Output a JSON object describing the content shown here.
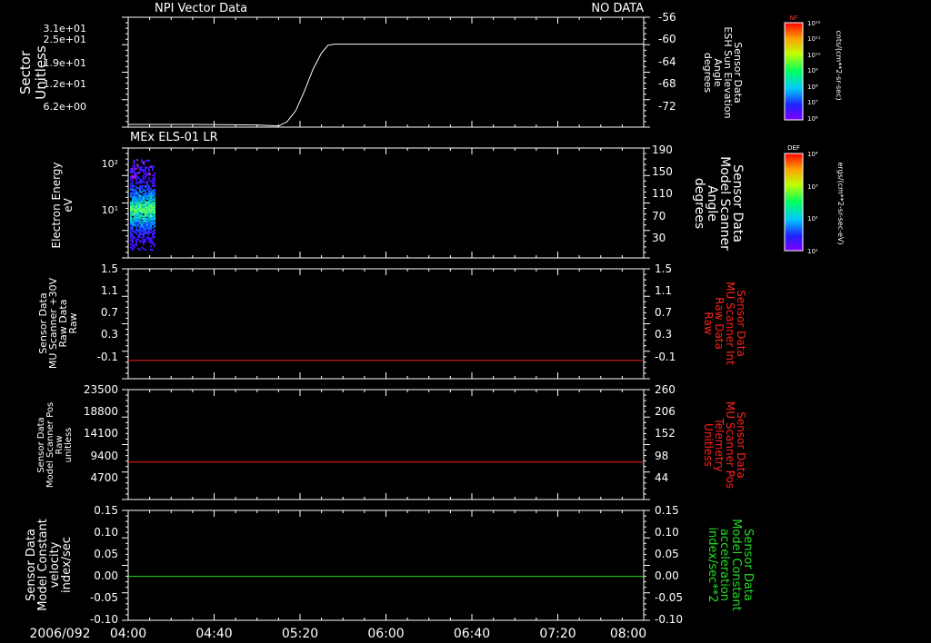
{
  "date_label": "2006/092",
  "time_ticks": [
    "04:00",
    "04:40",
    "05:20",
    "06:00",
    "06:40",
    "07:20",
    "08:00"
  ],
  "colorbars": [
    {
      "title": "NF",
      "unit": "cnts/(cm**2-sr-sec)",
      "tick_labels": [
        "10¹²",
        "10¹¹",
        "10¹⁰",
        "10⁹",
        "10⁸",
        "10⁷",
        "10⁶"
      ],
      "log_range": [
        6,
        12
      ]
    },
    {
      "title": "DEF",
      "unit": "ergs/(cm**2-sr-sec-eV)",
      "tick_labels": [
        "10⁴",
        "10³",
        "10²",
        "10¹"
      ],
      "log_range": [
        1,
        4
      ]
    }
  ],
  "panels": [
    {
      "id": "npi",
      "header_left": "NPI Vector Data",
      "header_right": "NO DATA",
      "left_label": [
        "Sector",
        "Unitless"
      ],
      "left_color": "#ffffff",
      "left_ticks": [
        "3.1e+01",
        "2.5e+01",
        "1.9e+01",
        "1.2e+01",
        "6.2e+00"
      ],
      "right_label": [
        "Sensor Data",
        "ESH Sun Elevation",
        "Angle",
        "degrees"
      ],
      "right_color": "#ffffff",
      "right_ticks": [
        "-56",
        "-60",
        "-64",
        "-68",
        "-72"
      ]
    },
    {
      "id": "els",
      "header_left": "MEx ELS-01 LR",
      "left_label": [
        "Electron Energy",
        "eV"
      ],
      "left_color": "#ffffff",
      "left_ticks": [
        "10²",
        "10¹"
      ],
      "right_label": [
        "Sensor Data",
        "Model Scanner",
        "Angle",
        "degrees"
      ],
      "right_color": "#ffffff",
      "right_ticks": [
        "190",
        "150",
        "110",
        "70",
        "30"
      ]
    },
    {
      "id": "mu_raw",
      "left_label": [
        "Sensor Data",
        "MU Scanner +30V",
        "Raw Data",
        "Raw"
      ],
      "left_color": "#ffffff",
      "left_ticks": [
        "1.5",
        "1.1",
        "0.7",
        "0.3",
        "-0.1"
      ],
      "right_label": [
        "Sensor Data",
        "MU Scanner Int",
        "Raw Data",
        "Raw"
      ],
      "right_color": "#ff2020",
      "right_ticks": [
        "1.5",
        "1.1",
        "0.7",
        "0.3",
        "-0.1"
      ]
    },
    {
      "id": "scanner_pos",
      "left_label": [
        "Sensor Data",
        "Model Scanner Pos",
        "Raw",
        "unitless"
      ],
      "left_color": "#ffffff",
      "left_ticks": [
        "23500",
        "18800",
        "14100",
        "9400",
        "4700"
      ],
      "right_label": [
        "Sensor Data",
        "MU Scanner Pos",
        "Telemetry",
        "Unitless"
      ],
      "right_color": "#ff2020",
      "right_ticks": [
        "260",
        "206",
        "152",
        "98",
        "44"
      ]
    },
    {
      "id": "constant",
      "left_label": [
        "Sensor Data",
        "Model Constant",
        "velocity",
        "index/sec"
      ],
      "left_color": "#ffffff",
      "left_ticks": [
        "0.15",
        "0.10",
        "0.05",
        "0.00",
        "-0.05",
        "-0.10"
      ],
      "right_label": [
        "Sensor Data",
        "Model Constant",
        "acceleration",
        "index/sec**2"
      ],
      "right_color": "#22dd22",
      "right_ticks": [
        "0.15",
        "0.10",
        "0.05",
        "0.00",
        "-0.05",
        "-0.10"
      ]
    }
  ],
  "chart_data": [
    {
      "type": "line",
      "panel": "npi",
      "ylabel": "Sensor Data ESH Sun Elevation Angle degrees",
      "yaxis": "right",
      "ylim": [
        -75,
        -55
      ],
      "xlim": [
        "04:00",
        "08:00"
      ],
      "series": [
        {
          "color": "#ffffff",
          "points": [
            [
              "04:00",
              -74.5
            ],
            [
              "04:30",
              -74.5
            ],
            [
              "05:00",
              -74.6
            ],
            [
              "05:10",
              -74.8
            ],
            [
              "05:14",
              -74.0
            ],
            [
              "05:18",
              -72.0
            ],
            [
              "05:22",
              -68.5
            ],
            [
              "05:26",
              -64.5
            ],
            [
              "05:30",
              -61.5
            ],
            [
              "05:33",
              -60.1
            ],
            [
              "05:36",
              -59.9
            ],
            [
              "08:00",
              -59.9
            ]
          ]
        }
      ]
    },
    {
      "type": "heatmap",
      "panel": "els",
      "ylabel": "Electron Energy eV",
      "yscale": "log",
      "x_range": [
        "04:00",
        "04:12"
      ],
      "y_range_eV": [
        1.5,
        95
      ],
      "colorbar": "DEF",
      "note": "spectrogram of differential energy flux; strongest near 10 eV"
    },
    {
      "type": "line",
      "panel": "mu_raw",
      "ylim": [
        -0.3,
        1.5
      ],
      "series": [
        {
          "color": "#ff2020",
          "points": [
            [
              "04:00",
              0.0
            ],
            [
              "08:00",
              0.0
            ]
          ]
        }
      ]
    },
    {
      "type": "line",
      "panel": "scanner_pos",
      "ylim": [
        0,
        23500
      ],
      "series": [
        {
          "color": "#ff2020",
          "points": [
            [
              "04:00",
              8000
            ],
            [
              "08:00",
              8000
            ]
          ]
        }
      ]
    },
    {
      "type": "line",
      "panel": "constant",
      "ylim": [
        -0.1,
        0.15
      ],
      "series": [
        {
          "color": "#22dd22",
          "points": [
            [
              "04:00",
              0.0
            ],
            [
              "08:00",
              0.0
            ]
          ]
        }
      ]
    }
  ]
}
